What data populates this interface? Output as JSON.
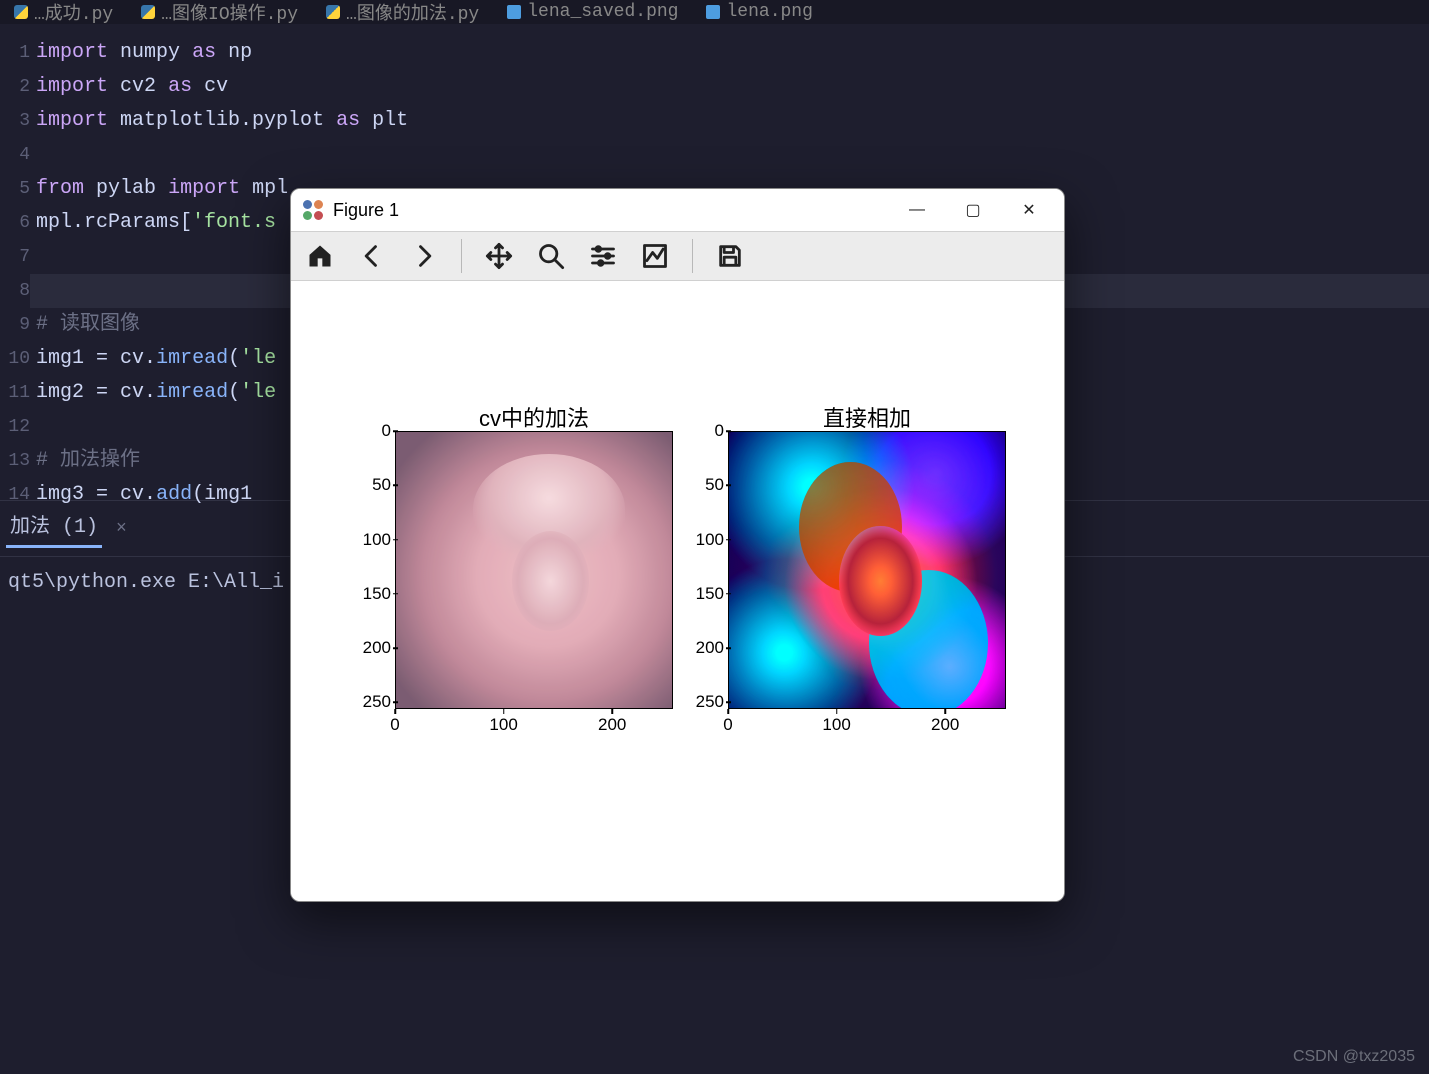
{
  "tabs": [
    {
      "label": "…成功.py",
      "kind": "py"
    },
    {
      "label": "…图像IO操作.py",
      "kind": "py"
    },
    {
      "label": "…图像的加法.py",
      "kind": "py"
    },
    {
      "label": "lena_saved.png",
      "kind": "img"
    },
    {
      "label": "lena.png",
      "kind": "img"
    }
  ],
  "code_lines": [
    {
      "n": "1",
      "html": "<span class='kw'>import</span> <span class='id'>numpy</span> <span class='as'>as</span> <span class='id'>np</span>"
    },
    {
      "n": "2",
      "html": "<span class='kw'>import</span> <span class='id'>cv2</span> <span class='as'>as</span> <span class='id'>cv</span>"
    },
    {
      "n": "3",
      "html": "<span class='kw'>import</span> <span class='id'>matplotlib.pyplot</span> <span class='as'>as</span> <span class='id'>plt</span>"
    },
    {
      "n": "4",
      "html": ""
    },
    {
      "n": "5",
      "html": "<span class='kw'>from</span> <span class='id'>pylab</span> <span class='kw'>import</span> <span class='id'>mpl</span>"
    },
    {
      "n": "6",
      "html": "<span class='id'>mpl.rcParams</span>[<span class='str'>'font.s</span>"
    },
    {
      "n": "7",
      "html": ""
    },
    {
      "n": "8",
      "html": "",
      "hl": true
    },
    {
      "n": "9",
      "html": "<span class='cm'># 读取图像</span>"
    },
    {
      "n": "10",
      "html": "<span class='id'>img1</span> = <span class='id'>cv</span>.<span class='fn'>imread</span>(<span class='str'>'le</span>"
    },
    {
      "n": "11",
      "html": "<span class='id'>img2</span> = <span class='id'>cv</span>.<span class='fn'>imread</span>(<span class='str'>'le</span>"
    },
    {
      "n": "12",
      "html": ""
    },
    {
      "n": "13",
      "html": "<span class='cm'># 加法操作</span>"
    },
    {
      "n": "14",
      "html": "<span class='id'>img3</span> = <span class='id'>cv</span>.<span class='fn'>add</span>(<span class='id'>img1</span>"
    }
  ],
  "panel": {
    "tab_label": "加法 (1)",
    "console_text": "qt5\\python.exe  E:\\All_i"
  },
  "figwin": {
    "title": "Figure 1",
    "toolbar": [
      "home",
      "back",
      "forward",
      "|",
      "pan",
      "zoom",
      "configure",
      "axes",
      "|",
      "save"
    ]
  },
  "chart_data": [
    {
      "type": "image",
      "title": "cv中的加法",
      "xticks": [
        0,
        100,
        200
      ],
      "yticks": [
        0,
        50,
        100,
        150,
        200,
        250
      ],
      "xlim": [
        0,
        256
      ],
      "ylim": [
        0,
        256
      ],
      "description": "Lena image result of cv.add (saturated addition), appears washed-out pink/light"
    },
    {
      "type": "image",
      "title": "直接相加",
      "xticks": [
        0,
        100,
        200
      ],
      "yticks": [
        0,
        50,
        100,
        150,
        200,
        250
      ],
      "xlim": [
        0,
        256
      ],
      "ylim": [
        0,
        256
      ],
      "description": "Lena image result of direct uint8 overflow addition, psychedelic cyan/magenta/brown wraparound colors"
    }
  ],
  "watermark": "CSDN @txz2035"
}
